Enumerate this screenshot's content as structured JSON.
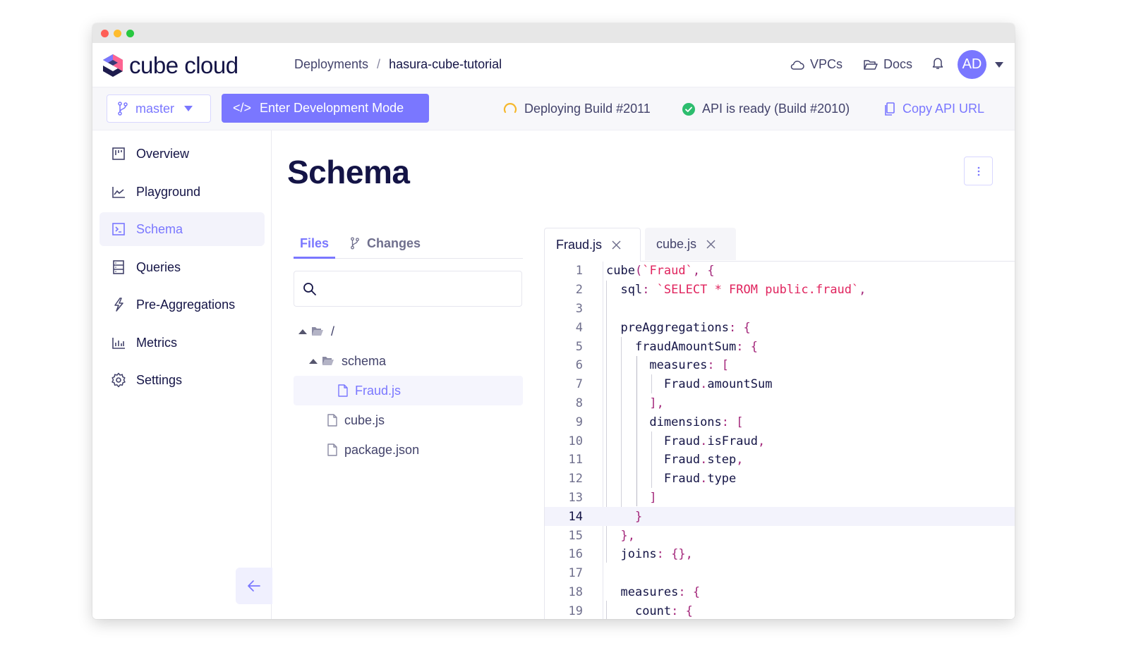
{
  "window": {
    "controls": [
      "close",
      "minimize",
      "maximize"
    ]
  },
  "header": {
    "logo_text": "cube cloud",
    "breadcrumb": {
      "parent": "Deployments",
      "separator": "/",
      "current": "hasura-cube-tutorial"
    },
    "links": [
      {
        "label": "VPCs",
        "icon": "cloud-icon"
      },
      {
        "label": "Docs",
        "icon": "folder-open-icon"
      }
    ],
    "notifications_icon": "bell-icon",
    "avatar_initials": "AD"
  },
  "toolbar": {
    "branch": "master",
    "dev_mode_label": "Enter Development Mode",
    "dev_mode_icon_text": "</>",
    "deploying_status": "Deploying Build #2011",
    "api_status": "API is ready (Build #2010)",
    "copy_api_label": "Copy API URL"
  },
  "sidebar": {
    "items": [
      {
        "label": "Overview",
        "icon": "kanban-icon",
        "active": false
      },
      {
        "label": "Playground",
        "icon": "line-chart-icon",
        "active": false
      },
      {
        "label": "Schema",
        "icon": "terminal-icon",
        "active": true
      },
      {
        "label": "Queries",
        "icon": "list-icon",
        "active": false
      },
      {
        "label": "Pre-Aggregations",
        "icon": "lightning-icon",
        "active": false
      },
      {
        "label": "Metrics",
        "icon": "bar-chart-icon",
        "active": false
      },
      {
        "label": "Settings",
        "icon": "gear-icon",
        "active": false
      }
    ],
    "collapse_icon": "arrow-left-icon"
  },
  "main": {
    "title": "Schema",
    "files_panel": {
      "tabs": [
        {
          "label": "Files",
          "active": true
        },
        {
          "label": "Changes",
          "active": false
        }
      ],
      "search": {
        "value": "",
        "placeholder": ""
      },
      "tree": [
        {
          "name": "/",
          "type": "folder",
          "depth": 0,
          "expanded": true
        },
        {
          "name": "schema",
          "type": "folder",
          "depth": 1,
          "expanded": true
        },
        {
          "name": "Fraud.js",
          "type": "file",
          "depth": 2,
          "selected": true
        },
        {
          "name": "cube.js",
          "type": "file",
          "depth": 1
        },
        {
          "name": "package.json",
          "type": "file",
          "depth": 1
        }
      ]
    },
    "editor": {
      "tabs": [
        {
          "label": "Fraud.js",
          "active": true
        },
        {
          "label": "cube.js",
          "active": false
        }
      ],
      "highlighted_line": 14,
      "lines": [
        "1",
        "2",
        "3",
        "4",
        "5",
        "6",
        "7",
        "8",
        "9",
        "10",
        "11",
        "12",
        "13",
        "14",
        "15",
        "16",
        "17",
        "18",
        "19"
      ]
    }
  },
  "colors": {
    "accent": "#7a77ff",
    "text_dark": "#141446",
    "string": "#e0245e",
    "punctuation": "#a3267a",
    "success": "#2dbd6e",
    "warning": "#f5b82e"
  }
}
